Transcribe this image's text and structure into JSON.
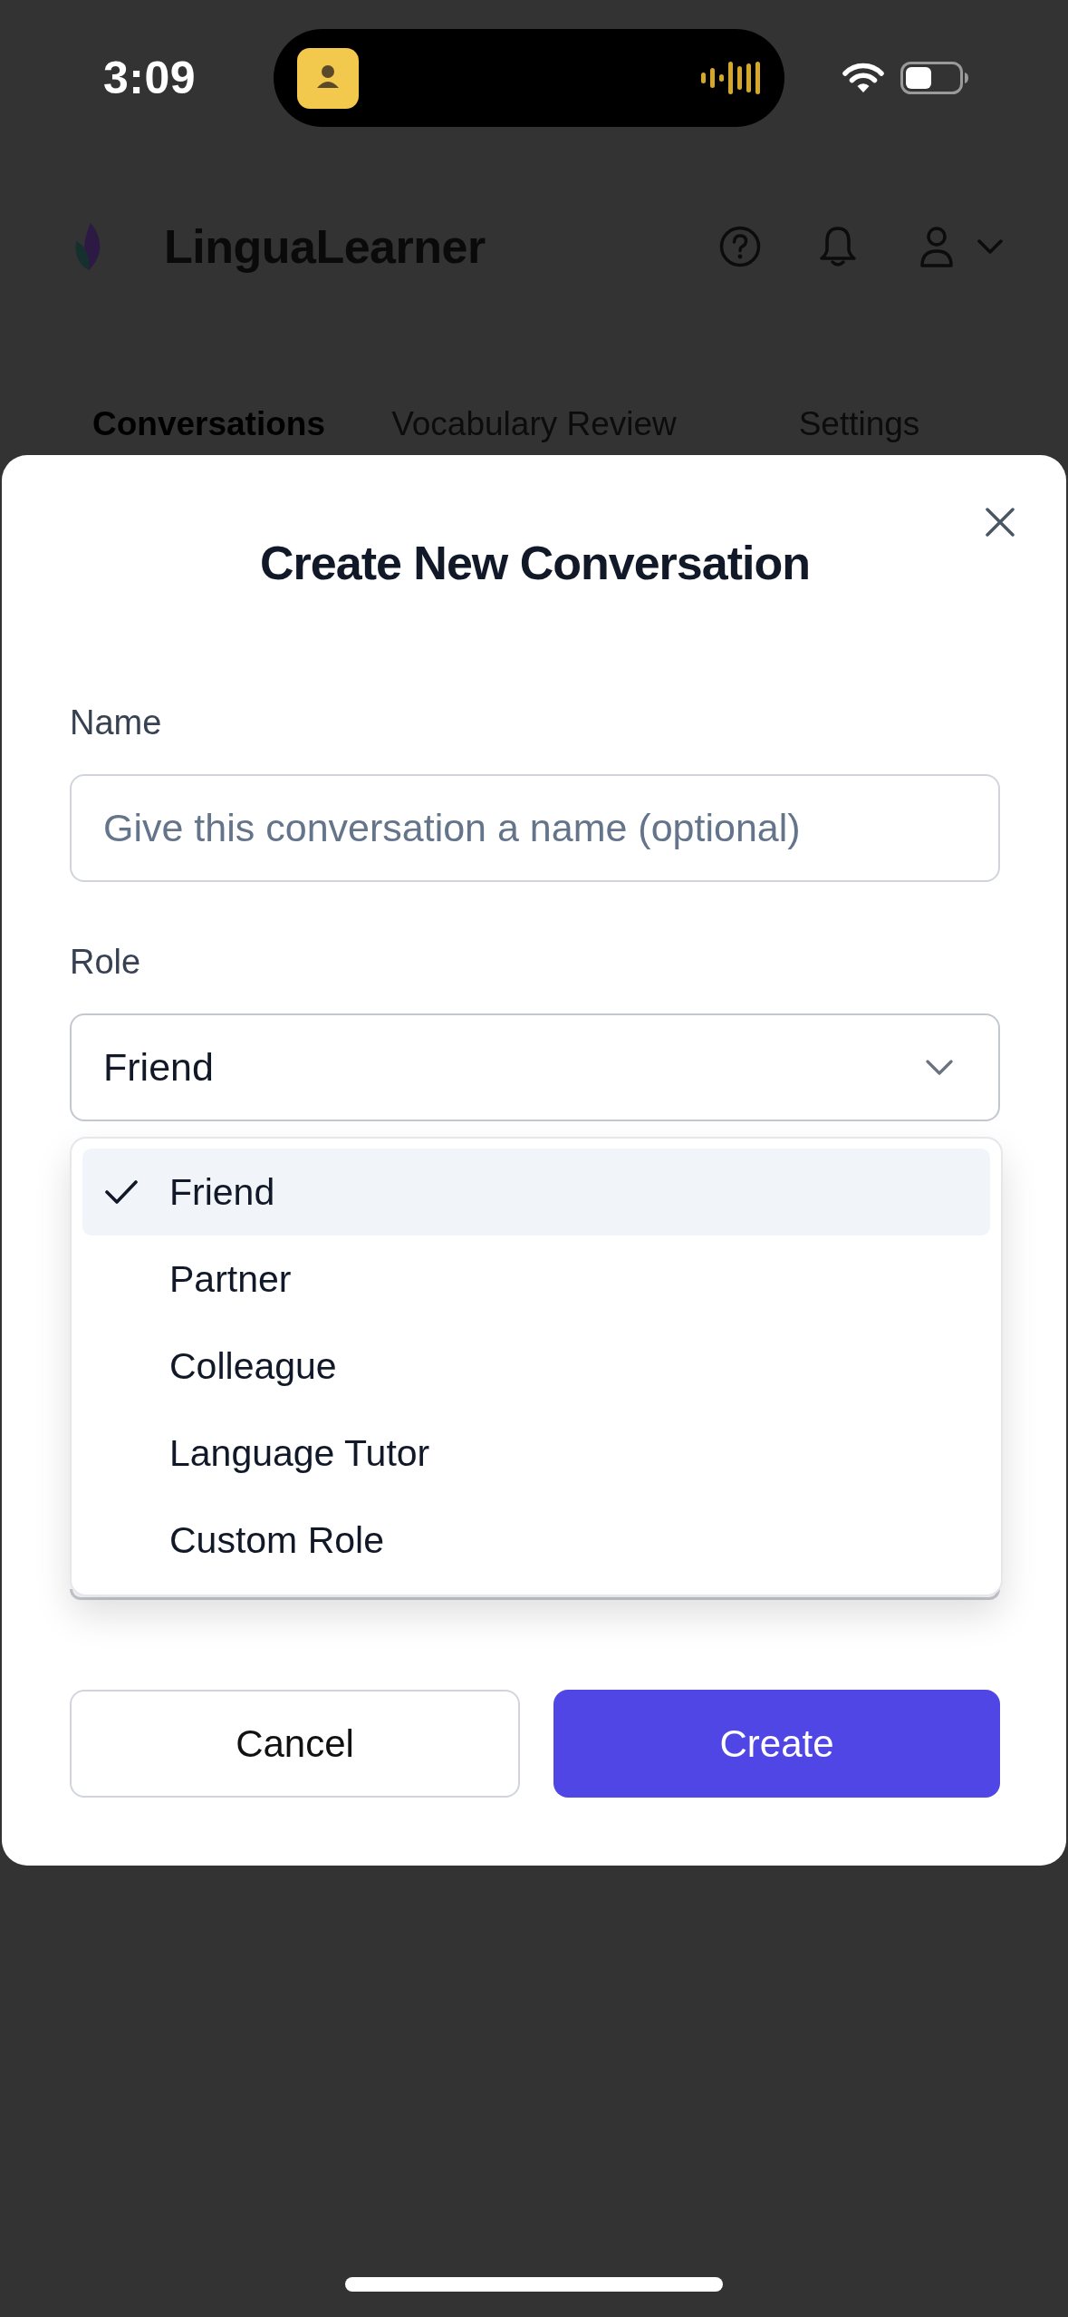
{
  "status_bar": {
    "time": "3:09"
  },
  "header": {
    "app_name": "LinguaLearner"
  },
  "tabs": [
    {
      "label": "Conversations",
      "selected": true
    },
    {
      "label": "Vocabulary Review",
      "selected": false
    },
    {
      "label": "Settings",
      "selected": false
    }
  ],
  "dialog": {
    "title": "Create New Conversation",
    "fields": [
      {
        "kind": "text",
        "label": "Name",
        "placeholder": "Give this conversation a name (optional)"
      },
      {
        "kind": "select",
        "label": "Role",
        "value": "Friend",
        "expanded": true,
        "options": [
          {
            "label": "Friend",
            "selected": true
          },
          {
            "label": "Partner",
            "selected": false
          },
          {
            "label": "Colleague",
            "selected": false
          },
          {
            "label": "Language Tutor",
            "selected": false
          },
          {
            "label": "Custom Role",
            "selected": false
          }
        ]
      }
    ],
    "buttons": [
      {
        "kind": "secondary",
        "label": "Cancel"
      },
      {
        "kind": "primary",
        "label": "Create"
      }
    ]
  }
}
